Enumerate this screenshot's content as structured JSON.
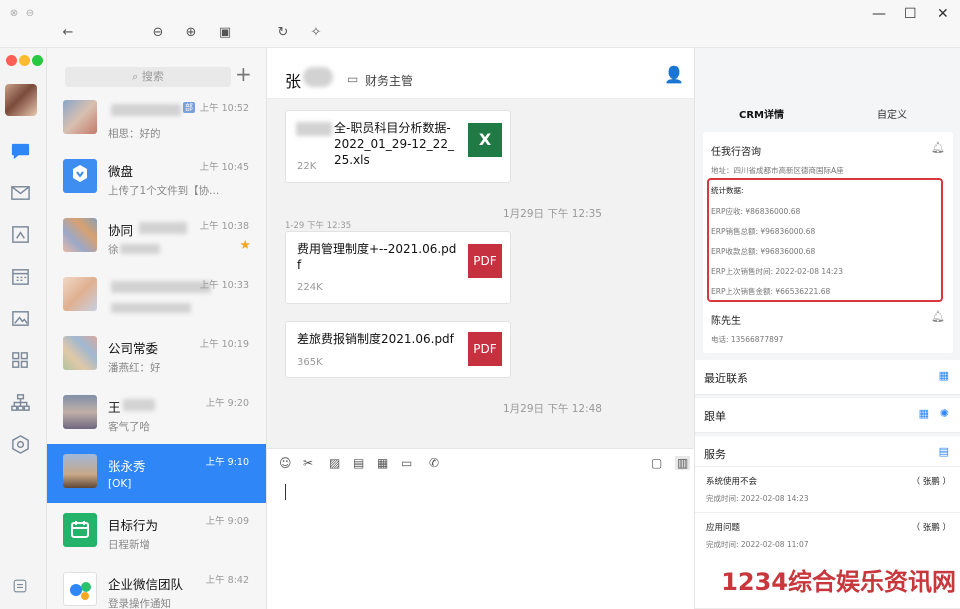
{
  "colors": {
    "accent": "#2f86f6",
    "excel": "#1f7a45",
    "pdf": "#c6313f",
    "highlight": "#d9363e"
  },
  "search": {
    "placeholder": "搜索"
  },
  "conversations": [
    {
      "name": "",
      "time": "上午 10:52",
      "preview": "相思：好的",
      "badge": "部"
    },
    {
      "name": "微盘",
      "time": "上午 10:45",
      "preview": "上传了1个文件到【协..."
    },
    {
      "name": "协同",
      "time": "上午 10:38",
      "preview": "徐",
      "starred": true
    },
    {
      "name": "",
      "time": "上午 10:33",
      "preview": ""
    },
    {
      "name": "公司常委",
      "time": "上午 10:19",
      "preview": "潘燕红：好"
    },
    {
      "name": "王",
      "time": "上午 9:20",
      "preview": "客气了哈"
    },
    {
      "name": "张永秀",
      "time": "上午 9:10",
      "preview": "[OK]",
      "selected": true
    },
    {
      "name": "目标行为",
      "time": "上午 9:09",
      "preview": "日程新增"
    },
    {
      "name": "企业微信团队",
      "time": "上午 8:42",
      "preview": "登录操作通知"
    }
  ],
  "chat": {
    "contact_name": "张",
    "contact_role": "财务主管",
    "messages": [
      {
        "file": "全-职员科目分析数据-2022_01_29-12_22_25.xls",
        "size": "22K",
        "type": "X"
      },
      {
        "stamp": "1月29日 下午 12:35"
      },
      {
        "sender_meta": "1-29 下午 12:35"
      },
      {
        "file": "费用管理制度+--2021.06.pdf",
        "size": "224K",
        "type": "PDF"
      },
      {
        "file": "差旅费报销制度2021.06.pdf",
        "size": "365K",
        "type": "PDF"
      },
      {
        "stamp": "1月29日 下午 12:48"
      }
    ]
  },
  "crm": {
    "tabs": [
      "CRM详情",
      "自定义"
    ],
    "company": {
      "name": "任我行咨询",
      "address": "地址：四川省成都市高新区德商国际A座"
    },
    "stats": {
      "title": "统计数据:",
      "rows": [
        "ERP应收: ¥86836000.68",
        "ERP销售总额: ¥96836000.68",
        "ERP收款总额: ¥96836000.68",
        "ERP上次销售时间: 2022-02-08 14:23",
        "ERP上次销售金额: ¥66536221.68"
      ]
    },
    "contact": {
      "name": "陈先生",
      "phone": "电话: 13566877897"
    },
    "sections": [
      "最近联系",
      "跟单",
      "服务"
    ],
    "service_items": [
      {
        "title": "系统使用不会",
        "who": "（ 张鹏 ）",
        "time": "完成时间: 2022-02-08 14:23"
      },
      {
        "title": "应用问题",
        "who": "（ 张鹏 ）",
        "time": "完成时间: 2022-02-08 11:07"
      }
    ]
  },
  "watermark": "1234综合娱乐资讯网"
}
